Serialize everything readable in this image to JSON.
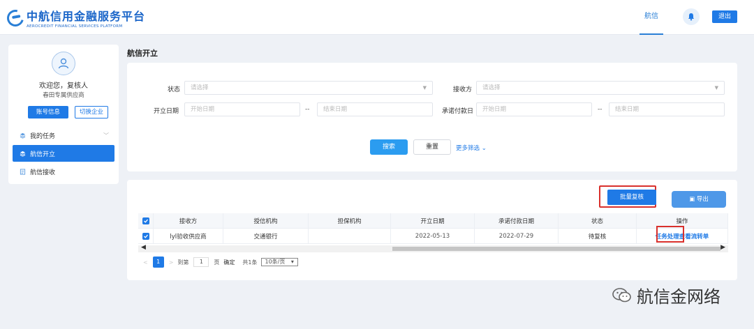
{
  "header": {
    "brand_cn": "中航信用金融服务平台",
    "brand_en": "AEROCREDIT FINANCIAL SERVICES PLATFORM",
    "nav_active": "航信",
    "logout": "退出"
  },
  "sidebar": {
    "welcome": "欢迎您，复核人",
    "company": "春田专属供应商",
    "btn_account": "账号信息",
    "btn_switch": "切换企业",
    "items": [
      {
        "label": "我的任务"
      },
      {
        "label": "航信开立"
      },
      {
        "label": "航信接收"
      }
    ]
  },
  "page": {
    "title": "航信开立"
  },
  "filters": {
    "status_label": "状态",
    "status_placeholder": "请选择",
    "receiver_label": "接收方",
    "receiver_placeholder": "请选择",
    "open_date_label": "开立日期",
    "start_placeholder": "开始日期",
    "end_placeholder": "结束日期",
    "range_sep": "--",
    "pay_date_label": "承诺付款日",
    "search": "搜索",
    "reset": "重置",
    "more": "更多筛选"
  },
  "table": {
    "batch_review": "批量复核",
    "export": "导出",
    "columns": [
      "接收方",
      "授信机构",
      "担保机构",
      "开立日期",
      "承诺付款日期",
      "状态",
      "操作"
    ],
    "rows": [
      {
        "receiver": "lyl验收供应商",
        "credit_org": "交通银行",
        "guarantee_org": "",
        "open_date": "2022-05-13",
        "pay_date": "2022-07-29",
        "status": "待复核",
        "ops": "任务处理查看流转单"
      }
    ]
  },
  "pagination": {
    "prev": "<",
    "current": "1",
    "next": ">",
    "goto": "到第",
    "page_input": "1",
    "page_unit": "页",
    "confirm": "确定",
    "total": "共1条",
    "page_size": "10条/页"
  },
  "watermark": {
    "text": "航信金网络"
  }
}
